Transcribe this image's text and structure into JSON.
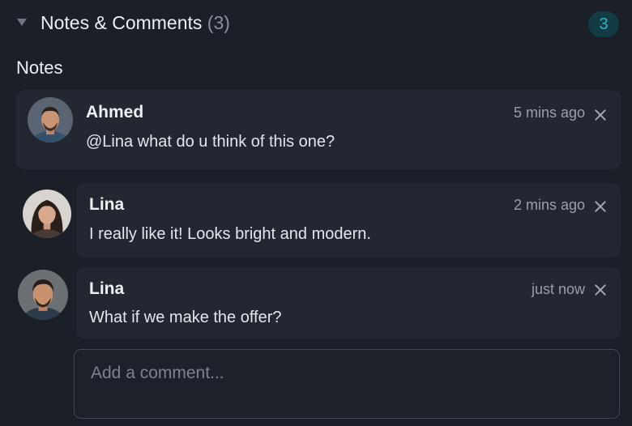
{
  "header": {
    "title": "Notes & Comments",
    "count_text": "(3)",
    "badge": "3"
  },
  "notes_label": "Notes",
  "comments": [
    {
      "author": "Ahmed",
      "time": "5 mins ago",
      "text": "@Lina what do u think of this one?"
    },
    {
      "author": "Lina",
      "time": "2 mins ago",
      "text": "I really like it! Looks bright and modern."
    },
    {
      "author": "Lina",
      "time": "just now",
      "text": "What if we make the offer?"
    }
  ],
  "input": {
    "placeholder": "Add a comment..."
  },
  "colors": {
    "background": "#1b1f27",
    "card": "#222731",
    "accent": "#2fb3c4",
    "badge_bg": "#123b44"
  }
}
